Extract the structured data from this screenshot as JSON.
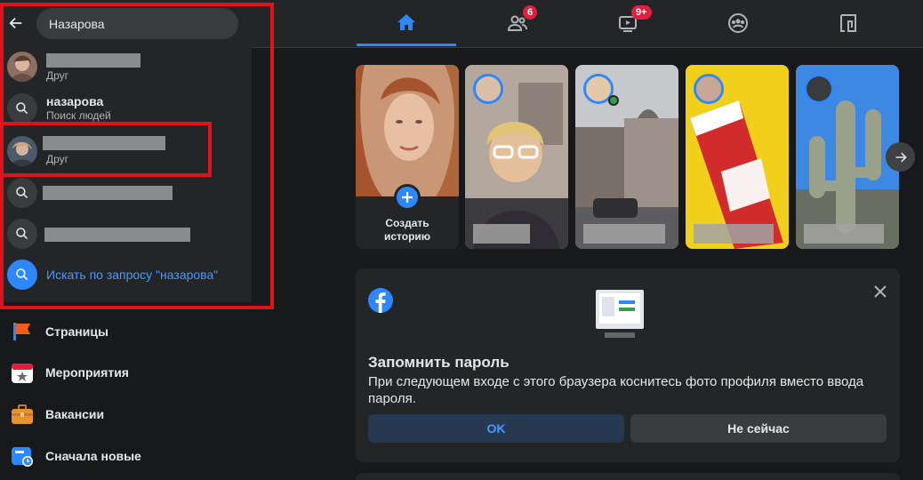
{
  "search": {
    "query": "Назарова",
    "results": [
      {
        "type": "person",
        "subtitle": "Друг"
      },
      {
        "type": "query",
        "title": "назарова",
        "subtitle": "Поиск людей"
      },
      {
        "type": "person",
        "subtitle": "Друг"
      },
      {
        "type": "query"
      },
      {
        "type": "query"
      },
      {
        "type": "search-all",
        "title": "Искать по запросу \"назарова\""
      }
    ]
  },
  "nav": {
    "tabs": [
      {
        "name": "home",
        "active": true
      },
      {
        "name": "friends",
        "badge": "6"
      },
      {
        "name": "watch",
        "badge": "9+"
      },
      {
        "name": "groups"
      },
      {
        "name": "gaming"
      }
    ]
  },
  "sidebar": {
    "items": [
      {
        "label": "Страницы",
        "icon": "flag-icon"
      },
      {
        "label": "Мероприятия",
        "icon": "calendar-star-icon"
      },
      {
        "label": "Вакансии",
        "icon": "briefcase-icon"
      },
      {
        "label": "Сначала новые",
        "icon": "clock-feed-icon"
      }
    ]
  },
  "stories": {
    "create_label_1": "Создать",
    "create_label_2": "историю"
  },
  "password_card": {
    "title": "Запомнить пароль",
    "text": "При следующем входе с этого браузера коснитесь фото профиля вместо ввода пароля.",
    "ok_label": "OK",
    "later_label": "Не сейчас"
  },
  "colors": {
    "accent": "#2d88ff",
    "badge": "#e41e3f",
    "highlight_box": "#e2121c"
  }
}
